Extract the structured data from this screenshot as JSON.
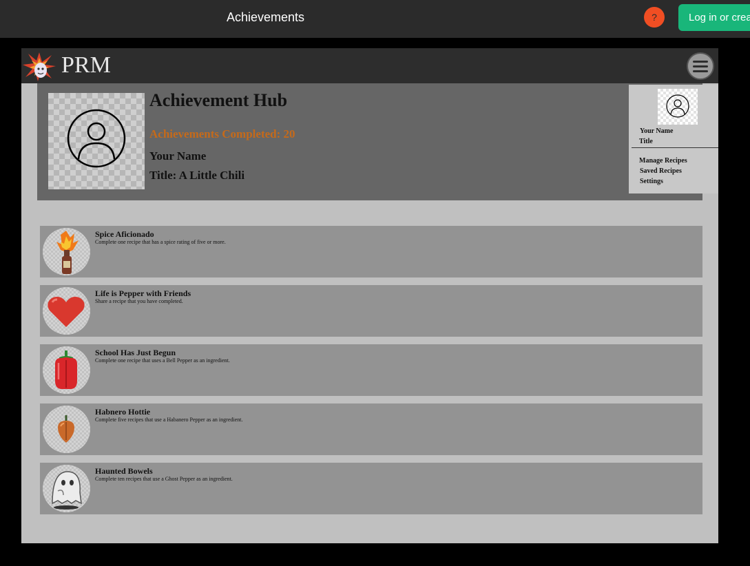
{
  "appbar": {
    "title": "Achievements",
    "help_label": "?",
    "login_label": "Log in or create account"
  },
  "site": {
    "brand": "PRM"
  },
  "hub": {
    "title": "Achievement Hub",
    "completed": "Achievements Completed: 20",
    "name": "Your Name",
    "rank": "Title: A Little Chili"
  },
  "dropdown": {
    "name": "Your Name",
    "rank": "Title",
    "items": [
      "Manage Recipes",
      "Saved Recipes",
      "Settings"
    ]
  },
  "achievements": [
    {
      "title": "Spice Aficionado",
      "description": "Complete one recipe that has a spice rating of five or more.",
      "icon": "hot-sauce-icon"
    },
    {
      "title": "Life is Pepper with Friends",
      "description": "Share a recipe that you have completed.",
      "icon": "heart-icon"
    },
    {
      "title": "School Has Just Begun",
      "description": "Complete one recipe that uses a Bell Pepper as an ingredient.",
      "icon": "bell-pepper-icon"
    },
    {
      "title": "Habnero Hottie",
      "description": "Complete five recipes that use a Habanero Pepper as an ingredient.",
      "icon": "habanero-icon"
    },
    {
      "title": "Haunted Bowels",
      "description": "Complete ten recipes that use a Ghost Pepper as an ingredient.",
      "icon": "ghost-icon"
    }
  ],
  "colors": {
    "help_button": "#f04e23",
    "login_button": "#19b67a",
    "completed_text": "#c56a1a"
  }
}
